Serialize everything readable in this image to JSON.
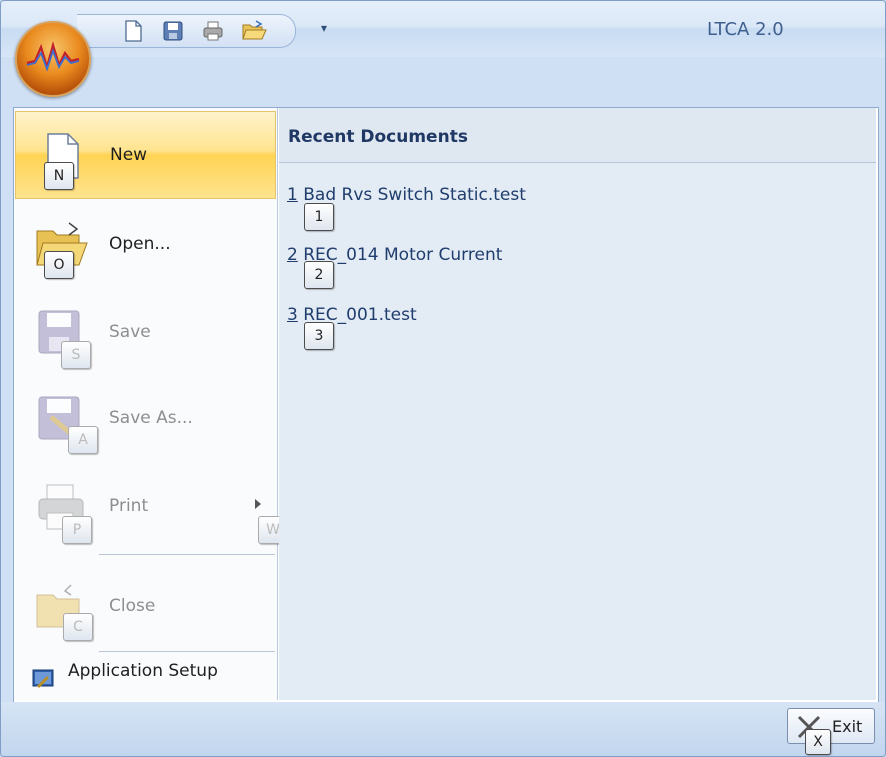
{
  "app": {
    "title": "LTCA 2.0"
  },
  "quick_access_toolbar": [
    "new-document-icon",
    "save-icon",
    "print-icon",
    "open-folder-icon"
  ],
  "recent_documents": {
    "header": "Recent Documents",
    "items": [
      {
        "number": "1",
        "name": "Bad Rvs Switch Static.test",
        "keytip": "1"
      },
      {
        "number": "2",
        "name": "REC_014 Motor Current",
        "keytip": "2"
      },
      {
        "number": "3",
        "name": "REC_001.test",
        "keytip": "3"
      }
    ]
  },
  "menu": {
    "items": [
      {
        "id": "new",
        "label": "New",
        "keytip": "N",
        "enabled": true,
        "highlighted": true
      },
      {
        "id": "open",
        "label": "Open...",
        "keytip": "O",
        "enabled": true
      },
      {
        "id": "save",
        "label": "Save",
        "keytip": "S",
        "enabled": false
      },
      {
        "id": "save_as",
        "label": "Save As...",
        "keytip": "A",
        "enabled": false
      },
      {
        "id": "print",
        "label": "Print",
        "keytip": "P",
        "submenu_keytip": "W",
        "enabled": false
      },
      {
        "id": "close",
        "label": "Close",
        "keytip": "C",
        "enabled": false
      }
    ],
    "application_setup": "Application Setup"
  },
  "footer": {
    "exit_label": "Exit",
    "exit_keytip": "X"
  }
}
